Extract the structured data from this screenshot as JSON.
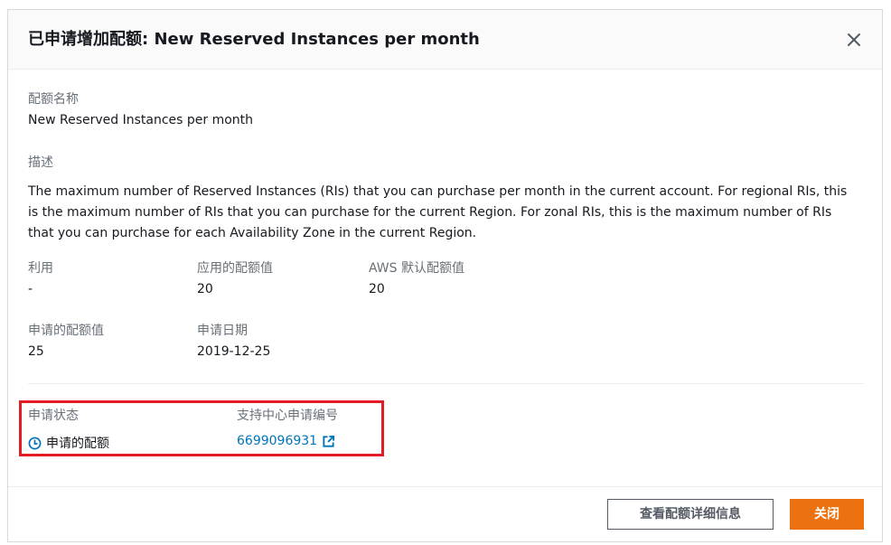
{
  "modal": {
    "title": "已申请增加配额: New Reserved Instances per month",
    "quota_name_label": "配额名称",
    "quota_name_value": "New Reserved Instances per month",
    "description_label": "描述",
    "description_value": "The maximum number of Reserved Instances (RIs) that you can purchase per month in the current account. For regional RIs, this is the maximum number of RIs that you can purchase for the current Region. For zonal RIs, this is the maximum number of RIs that you can purchase for each Availability Zone in the current Region.",
    "utilization_label": "利用",
    "utilization_value": "-",
    "applied_quota_label": "应用的配额值",
    "applied_quota_value": "20",
    "aws_default_label": "AWS 默认配额值",
    "aws_default_value": "20",
    "requested_quota_label": "申请的配额值",
    "requested_quota_value": "25",
    "request_date_label": "申请日期",
    "request_date_value": "2019-12-25",
    "request_status_label": "申请状态",
    "request_status_value": "申请的配额",
    "support_case_label": "支持中心申请编号",
    "support_case_value": "6699096931"
  },
  "footer": {
    "view_details_label": "查看配额详细信息",
    "close_label": "关闭"
  },
  "icons": {
    "close": "close-icon",
    "status": "clock-icon",
    "external": "external-link-icon"
  },
  "colors": {
    "primary": "#ec7211",
    "link": "#0073bb",
    "highlight": "#e31b23",
    "label": "#687078"
  }
}
